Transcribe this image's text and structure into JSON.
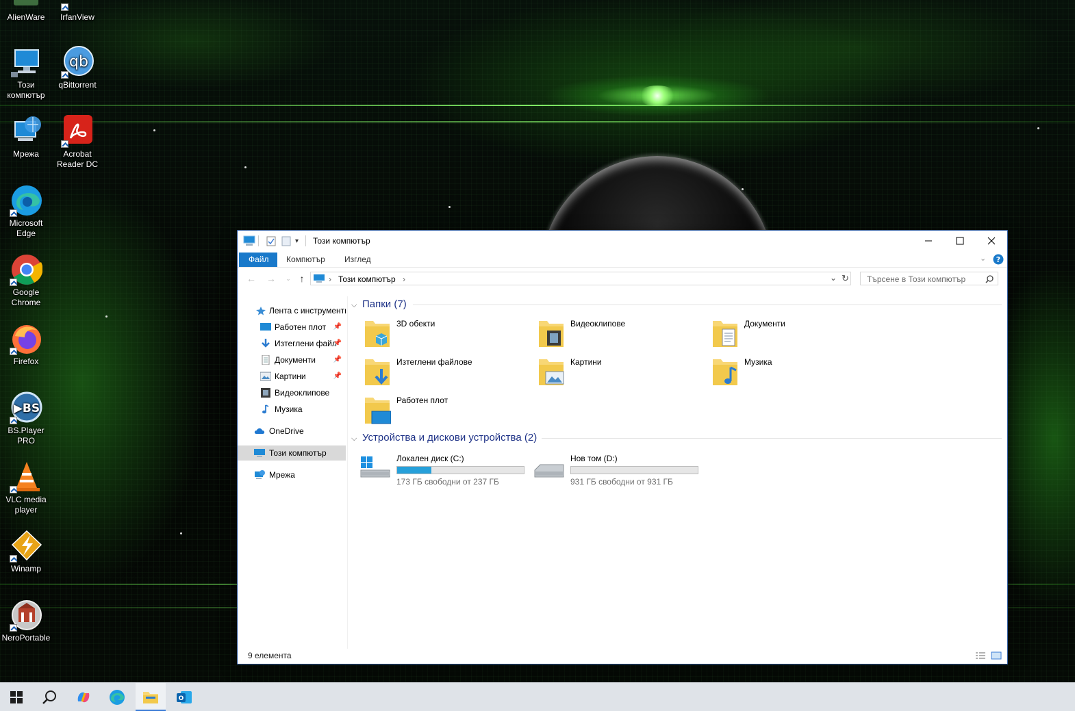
{
  "desktop": {
    "icons": [
      {
        "label": "AlienWare"
      },
      {
        "label": "IrfanView"
      },
      {
        "label": "Този компютър"
      },
      {
        "label": "qBittorrent"
      },
      {
        "label": "Мрежа"
      },
      {
        "label": "Acrobat Reader DC"
      },
      {
        "label": "Microsoft Edge"
      },
      {
        "label": "Google Chrome"
      },
      {
        "label": "Firefox"
      },
      {
        "label": "BS.Player PRO"
      },
      {
        "label": "VLC media player"
      },
      {
        "label": "Winamp"
      },
      {
        "label": "NeroPortable"
      }
    ]
  },
  "window": {
    "title": "Този компютър",
    "ribbon_tabs": [
      "Файл",
      "Компютър",
      "Изглед"
    ],
    "address": {
      "crumb": "Този компютър"
    },
    "search": {
      "placeholder": "Търсене в Този компютър"
    },
    "nav": {
      "items": [
        {
          "label": "Лента с инструменти",
          "pinned": false
        },
        {
          "label": "Работен плот",
          "pinned": true
        },
        {
          "label": "Изтеглени файл",
          "pinned": true
        },
        {
          "label": "Документи",
          "pinned": true
        },
        {
          "label": "Картини",
          "pinned": true
        },
        {
          "label": "Видеоклипове",
          "pinned": false
        },
        {
          "label": "Музика",
          "pinned": false
        },
        {
          "label": "OneDrive",
          "pinned": false
        },
        {
          "label": "Този компютър",
          "pinned": false,
          "selected": true
        },
        {
          "label": "Мрежа",
          "pinned": false
        }
      ]
    },
    "groups": {
      "folders": {
        "title": "Папки (7)",
        "items": [
          {
            "name": "3D обекти"
          },
          {
            "name": "Видеоклипове"
          },
          {
            "name": "Документи"
          },
          {
            "name": "Изтеглени файлове"
          },
          {
            "name": "Картини"
          },
          {
            "name": "Музика"
          },
          {
            "name": "Работен плот"
          }
        ]
      },
      "drives": {
        "title": "Устройства и дискови устройства (2)",
        "items": [
          {
            "name": "Локален диск (C:)",
            "free": "173 ГБ свободни от 237 ГБ",
            "used_fraction": 0.27
          },
          {
            "name": "Нов том (D:)",
            "free": "931 ГБ свободни от 931 ГБ",
            "used_fraction": 0.0
          }
        ]
      }
    },
    "status": {
      "count": "9 елемента"
    }
  },
  "colors": {
    "accent": "#1979ca",
    "drive_fill": "#26a0da",
    "group_title": "#1e3287"
  },
  "taskbar": {
    "items": [
      "start-icon",
      "search-icon",
      "copilot-icon",
      "edge-icon",
      "file-explorer-icon",
      "outlook-icon"
    ],
    "active": "file-explorer-icon"
  }
}
